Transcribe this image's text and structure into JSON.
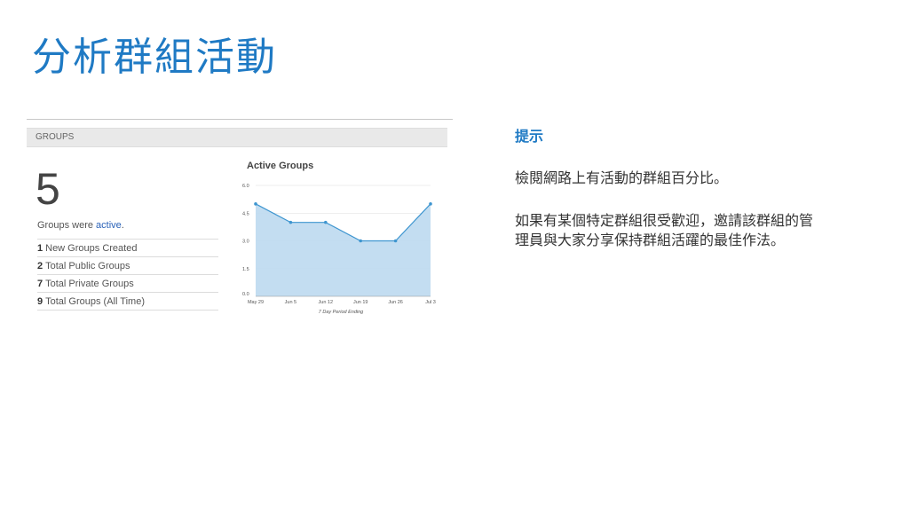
{
  "slide": {
    "title": "分析群組活動"
  },
  "widget": {
    "header": "GROUPS",
    "big_number": "5",
    "active_prefix": "Groups were ",
    "active_link": "active",
    "active_suffix": ".",
    "stats": [
      {
        "count": "1",
        "label": "New Groups Created"
      },
      {
        "count": "2",
        "label": "Total Public Groups"
      },
      {
        "count": "7",
        "label": "Total Private Groups"
      },
      {
        "count": "9",
        "label": "Total Groups (All Time)"
      }
    ]
  },
  "chart_data": {
    "type": "area",
    "title": "Active Groups",
    "xlabel": "7 Day Period Ending",
    "ylabel": "",
    "categories": [
      "May 29",
      "Jun 5",
      "Jun 12",
      "Jun 19",
      "Jun 26",
      "Jul 3"
    ],
    "values": [
      5,
      4,
      4,
      3,
      3,
      5
    ],
    "yticks": [
      "6.0",
      "4.5",
      "3.0",
      "1.5",
      "0.0"
    ],
    "ylim": [
      0,
      6
    ],
    "grid": true,
    "colors": {
      "fill": "#bcd9ef",
      "line": "#3f96d0",
      "grid": "#dddddd"
    }
  },
  "tip": {
    "heading": "提示",
    "p1": "檢閱網路上有活動的群組百分比。",
    "p2": "如果有某個特定群組很受歡迎，邀請該群組的管理員與大家分享保持群組活躍的最佳作法。"
  }
}
